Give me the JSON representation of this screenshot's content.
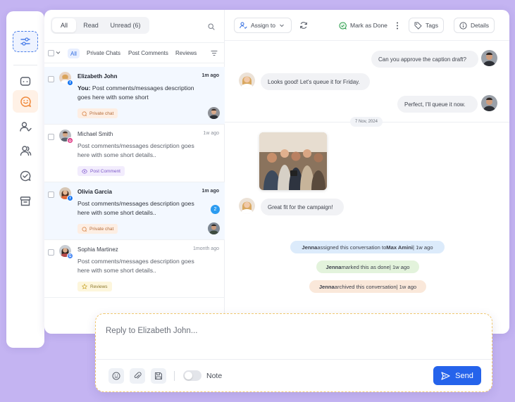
{
  "colors": {
    "background": "#c4b4f2",
    "accent": "#2563eb",
    "send": "#2563eb",
    "composer_border": "#f0c870"
  },
  "sidebar": {
    "icons": [
      "filter-settings-icon",
      "chat-square-icon",
      "smile-chat-icon",
      "user-check-icon",
      "users-icon",
      "check-circle-icon",
      "archive-icon"
    ],
    "active": "smile-chat-icon"
  },
  "inbox": {
    "tabs": {
      "all": "All",
      "read": "Read",
      "unread": "Unread (6)"
    },
    "filters": {
      "all": "All",
      "private": "Private Chats",
      "post": "Post Comments",
      "reviews": "Reviews"
    }
  },
  "conversations": [
    {
      "name": "Elizabeth John",
      "time": "1m ago",
      "prefix": "You:",
      "text": " Post comments/messages description goes here with some short",
      "tag": "Private chat",
      "channel": "facebook",
      "unread": true
    },
    {
      "name": "Michael Smith",
      "time": "1w ago",
      "text": "Post comments/messages description goes here with some short details..",
      "tag": "Post Comment",
      "channel": "instagram",
      "unread": false
    },
    {
      "name": "Olivia Garcia",
      "time": "1m ago",
      "text": "Post comments/messages description goes here with some short details..",
      "tag": "Private chat",
      "channel": "facebook",
      "badge": "2",
      "unread": true
    },
    {
      "name": "Sophia Martinez",
      "time": "1month ago",
      "text": "Post comments/messages description goes here with some short details..",
      "tag": "Reviews",
      "channel": "google",
      "unread": false
    }
  ],
  "chat_header": {
    "assign": "Assign to",
    "mark_done": "Mark as Done",
    "tags": "Tags",
    "details": "Details"
  },
  "messages": {
    "m1": "Can you approve the caption draft?",
    "m2": "Looks good! Let's queue it for Friday.",
    "m3": "Perfect, I'll queue it now.",
    "date": "7 Nov, 2024",
    "m4": "Great fit for the campaign!"
  },
  "system_events": {
    "assigned": {
      "actor": "Jenna",
      "mid": " assigned this conversation to ",
      "target": "Max Amini",
      "time": " | 1w ago"
    },
    "done": {
      "actor": "Jenna",
      "text": " marked this as done",
      "time": " | 1w ago"
    },
    "archived": {
      "actor": "Jenna",
      "text": " archived this conversation",
      "time": " | 1w ago"
    }
  },
  "composer": {
    "placeholder": "Reply to Elizabeth John...",
    "note": "Note",
    "send": "Send"
  }
}
